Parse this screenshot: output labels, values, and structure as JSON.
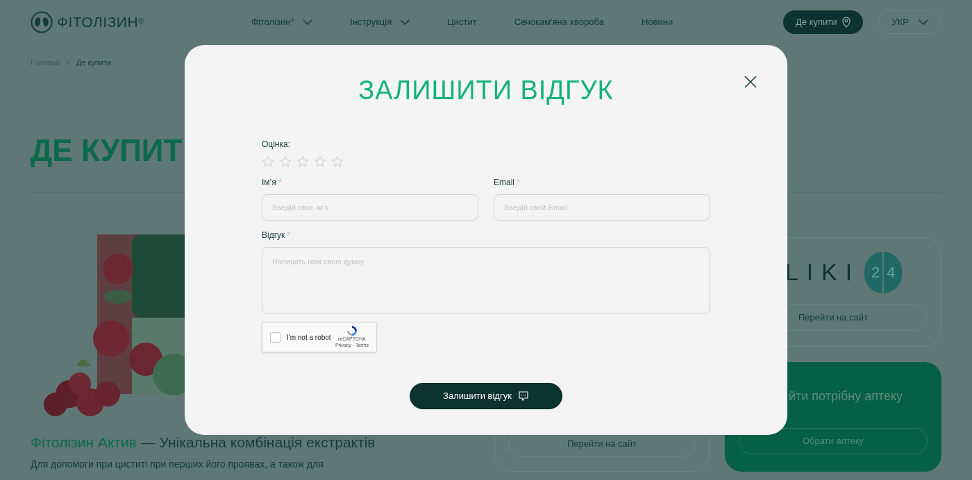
{
  "header": {
    "logo": "ФІТОЛІЗИН",
    "logo_mark": "®",
    "nav": [
      {
        "label": "Фітолізин",
        "sup": "®",
        "kind": "dropdown"
      },
      {
        "label": "Інструкція",
        "kind": "dropdown"
      },
      {
        "label": "Цистит",
        "kind": "link"
      },
      {
        "label": "Сечокам'яна хвороба",
        "kind": "link"
      },
      {
        "label": "Новини",
        "kind": "link"
      }
    ],
    "buy_button": "Де купити",
    "language": "УКР"
  },
  "breadcrumbs": [
    {
      "label": "Головна",
      "current": false
    },
    {
      "label": "Де купити",
      "current": true
    }
  ],
  "page_title": "ДЕ КУПИТ",
  "product": {
    "title_highlight": "Фітолізин Актив",
    "title_rest": "— Унікальна комбінація екстрактів",
    "description": "Для допомоги при циститі при перших його проявах, а також для"
  },
  "middle_card": {
    "button": "Перейти на сайт"
  },
  "liki_card": {
    "logo": "LIKI",
    "badge": [
      "2",
      "4"
    ],
    "button": "Перейти на сайт"
  },
  "pharmacy_card": {
    "title": "йти потрібну аптеку",
    "button": "Обрати аптеку"
  },
  "modal": {
    "title": "ЗАЛИШИТИ ВІДГУК",
    "rating_label": "Оцінка:",
    "stars": 0,
    "fields": [
      {
        "label": "Ім’я",
        "asterisk": "*",
        "placeholder": "Введій своє ім’я",
        "kind": "input"
      },
      {
        "label": "Email",
        "asterisk": "*",
        "placeholder": "Введій свой Email",
        "kind": "input"
      },
      {
        "label": "Відгук",
        "asterisk": "*",
        "placeholder": "Напишіть нам свою думку",
        "kind": "textarea"
      }
    ],
    "captcha": {
      "label": "I'm not a robot",
      "checked": false,
      "brand": "reCAPTCHA",
      "links": "Privacy - Terms"
    },
    "submit": "Залишити відгук"
  }
}
